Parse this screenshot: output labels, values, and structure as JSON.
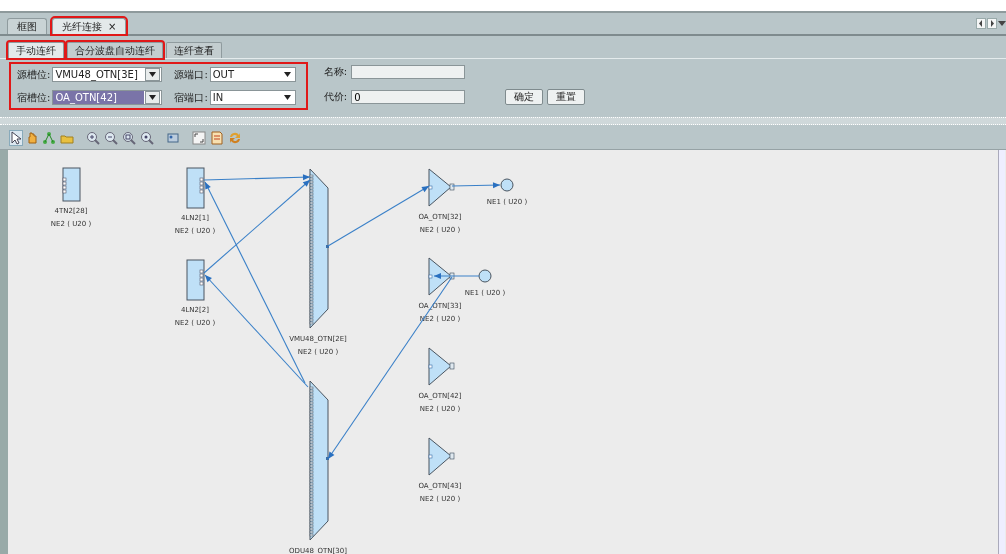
{
  "tabs": [
    {
      "label": "框图",
      "selected": false,
      "highlighted": false
    },
    {
      "label": "光纤连接",
      "selected": true,
      "highlighted": true,
      "close": "×"
    }
  ],
  "subtabs": [
    {
      "label": "手动连纤",
      "selected": true,
      "highlighted": true
    },
    {
      "label": "合分波盘自动连纤",
      "selected": false,
      "highlighted": true
    },
    {
      "label": "连纤查看",
      "selected": false,
      "highlighted": false
    }
  ],
  "form": {
    "highlighted": true,
    "combos": [
      {
        "label": "源槽位:",
        "value": "VMU48_OTN[3E]",
        "selected": false
      },
      {
        "label": "源端口:",
        "value": "OUT",
        "selected": false
      },
      {
        "label": "宿槽位:",
        "value": "OA_OTN[42]",
        "selected": true
      },
      {
        "label": "宿端口:",
        "value": "IN",
        "selected": false
      }
    ],
    "name_field": {
      "label": "名称:"
    },
    "cost_field": {
      "label": "代价:",
      "value": "0"
    },
    "buttons": [
      "确定",
      "重置"
    ]
  },
  "diagram": {
    "nodes": [
      {
        "kind": "card",
        "name": "4TN2[28]",
        "ne": "NE2 ( U20 )"
      },
      {
        "kind": "card",
        "name": "4LN2[1]",
        "ne": "NE2 ( U20 )"
      },
      {
        "kind": "card",
        "name": "4LN2[2]",
        "ne": "NE2 ( U20 )"
      },
      {
        "kind": "mux",
        "name": "VMU48_OTN[2E]",
        "ne": "NE2 ( U20 )"
      },
      {
        "kind": "mux",
        "name": "ODU48_OTN[30]"
      },
      {
        "kind": "amp",
        "name": "OA_OTN[32]",
        "ne": "NE2 ( U20 )"
      },
      {
        "kind": "peer",
        "ne": "NE1 ( U20 )"
      },
      {
        "kind": "amp",
        "name": "OA_OTN[33]",
        "ne": "NE2 ( U20 )"
      },
      {
        "kind": "peer",
        "ne": "NE1 ( U20 )"
      },
      {
        "kind": "amp",
        "name": "OA_OTN[42]",
        "ne": "NE2 ( U20 )"
      },
      {
        "kind": "amp",
        "name": "OA_OTN[43]",
        "ne": "NE2 ( U20 )"
      }
    ]
  }
}
